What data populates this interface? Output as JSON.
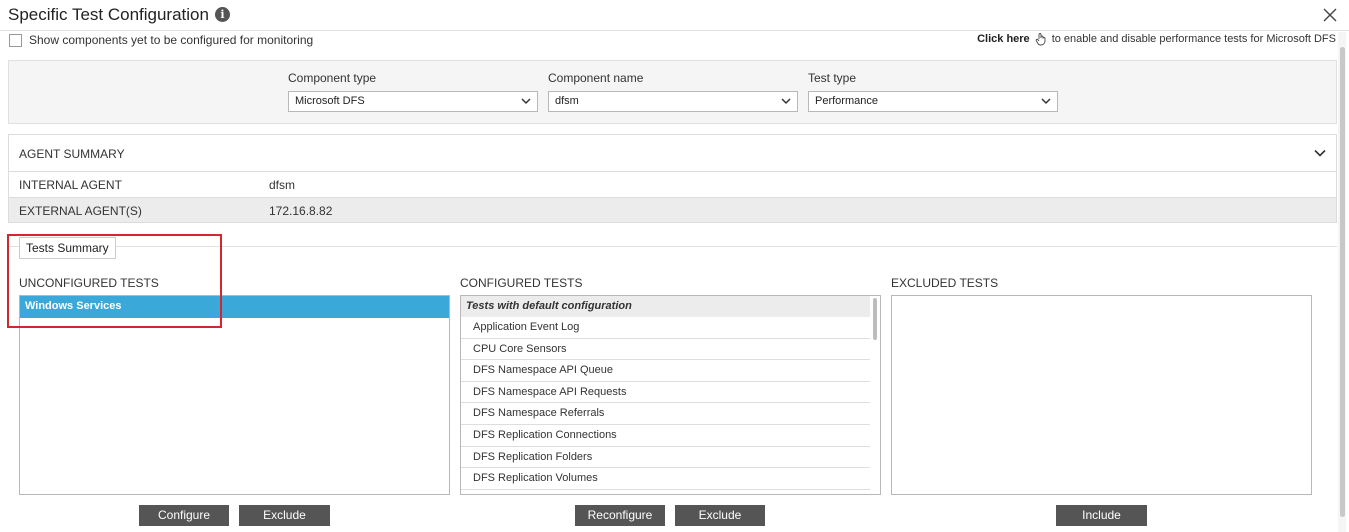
{
  "dialog": {
    "title": "Specific Test Configuration",
    "show_unconfigured_label": "Show components yet to be configured for monitoring",
    "click_here_label": "Click here",
    "click_here_suffix": "to enable and disable performance tests for Microsoft DFS"
  },
  "filters": {
    "component_type": {
      "label": "Component type",
      "value": "Microsoft DFS"
    },
    "component_name": {
      "label": "Component name",
      "value": "dfsm"
    },
    "test_type": {
      "label": "Test type",
      "value": "Performance"
    }
  },
  "agent_summary": {
    "title": "AGENT SUMMARY",
    "rows": [
      {
        "key": "INTERNAL AGENT",
        "value": "dfsm"
      },
      {
        "key": "EXTERNAL AGENT(S)",
        "value": "172.16.8.82"
      }
    ]
  },
  "tests_summary": {
    "tab_label": "Tests Summary",
    "unconfigured": {
      "title": "UNCONFIGURED TESTS",
      "items": [
        "Windows Services"
      ]
    },
    "configured": {
      "title": "CONFIGURED TESTS",
      "group": "Tests with default configuration",
      "items": [
        "Application Event Log",
        "CPU Core Sensors",
        "DFS Namespace API Queue",
        "DFS Namespace API Requests",
        "DFS Namespace Referrals",
        "DFS Replication Connections",
        "DFS Replication Folders",
        "DFS Replication Volumes"
      ]
    },
    "excluded": {
      "title": "EXCLUDED TESTS",
      "items": []
    }
  },
  "buttons": {
    "configure": "Configure",
    "exclude_unconfigured": "Exclude",
    "reconfigure": "Reconfigure",
    "exclude_configured": "Exclude",
    "include": "Include"
  },
  "colors": {
    "selection": "#3aa8d8",
    "button": "#555555",
    "highlight": "#d0282d"
  }
}
